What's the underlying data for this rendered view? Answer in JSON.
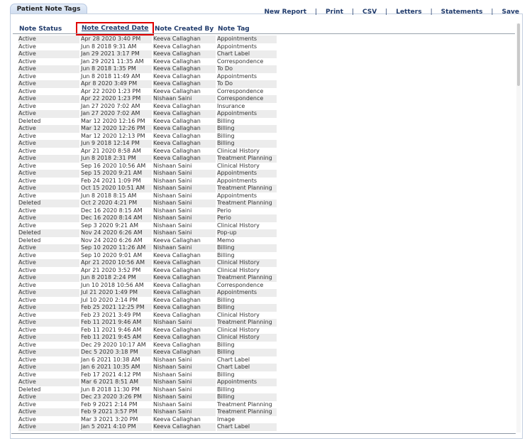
{
  "panel": {
    "title": "Patient Note Tags"
  },
  "toolbar": {
    "new_report": "New Report",
    "print": "Print",
    "csv": "CSV",
    "letters": "Letters",
    "statements": "Statements",
    "save": "Save",
    "separator": "|"
  },
  "table": {
    "columns": [
      "Note Status",
      "Note Created Date",
      "Note Created By",
      "Note Tag"
    ],
    "sorted_column": "Note Created Date",
    "rows": [
      [
        "Active",
        "Apr 28 2020 3:40 PM",
        "Keeva Callaghan",
        "Appointments"
      ],
      [
        "Active",
        "Jun 8 2018 9:31 AM",
        "Keeva Callaghan",
        "Appointments"
      ],
      [
        "Active",
        "Jan 29 2021 3:17 PM",
        "Keeva Callaghan",
        "Chart Label"
      ],
      [
        "Active",
        "Jan 29 2021 11:35 AM",
        "Keeva Callaghan",
        "Correspondence"
      ],
      [
        "Active",
        "Jun 8 2018 1:35 PM",
        "Keeva Callaghan",
        "To Do"
      ],
      [
        "Active",
        "Jun 8 2018 11:49 AM",
        "Keeva Callaghan",
        "Appointments"
      ],
      [
        "Active",
        "Apr 8 2020 3:49 PM",
        "Keeva Callaghan",
        "To Do"
      ],
      [
        "Active",
        "Apr 22 2020 1:23 PM",
        "Keeva Callaghan",
        "Correspondence"
      ],
      [
        "Active",
        "Apr 22 2020 1:23 PM",
        "Nishaan Saini",
        "Correspondence"
      ],
      [
        "Active",
        "Jan 27 2020 7:02 AM",
        "Keeva Callaghan",
        "Insurance"
      ],
      [
        "Active",
        "Jan 27 2020 7:02 AM",
        "Keeva Callaghan",
        "Appointments"
      ],
      [
        "Deleted",
        "Mar 12 2020 12:16 PM",
        "Keeva Callaghan",
        "Billing"
      ],
      [
        "Active",
        "Mar 12 2020 12:26 PM",
        "Keeva Callaghan",
        "Billing"
      ],
      [
        "Active",
        "Mar 12 2020 12:13 PM",
        "Keeva Callaghan",
        "Billing"
      ],
      [
        "Active",
        "Jun 9 2018 12:14 PM",
        "Keeva Callaghan",
        "Billing"
      ],
      [
        "Active",
        "Apr 21 2020 8:58 AM",
        "Keeva Callaghan",
        "Clinical History"
      ],
      [
        "Active",
        "Jun 8 2018 2:31 PM",
        "Keeva Callaghan",
        "Treatment Planning"
      ],
      [
        "Active",
        "Sep 16 2020 10:56 AM",
        "Nishaan Saini",
        "Clinical History"
      ],
      [
        "Active",
        "Sep 15 2020 9:21 AM",
        "Nishaan Saini",
        "Appointments"
      ],
      [
        "Active",
        "Feb 24 2021 1:09 PM",
        "Nishaan Saini",
        "Appointments"
      ],
      [
        "Active",
        "Oct 15 2020 10:51 AM",
        "Nishaan Saini",
        "Treatment Planning"
      ],
      [
        "Active",
        "Jun 8 2018 8:15 AM",
        "Nishaan Saini",
        "Appointments"
      ],
      [
        "Deleted",
        "Oct 2 2020 4:21 PM",
        "Nishaan Saini",
        "Treatment Planning"
      ],
      [
        "Active",
        "Dec 16 2020 8:15 AM",
        "Nishaan Saini",
        "Perio"
      ],
      [
        "Active",
        "Dec 16 2020 8:14 AM",
        "Nishaan Saini",
        "Perio"
      ],
      [
        "Active",
        "Sep 3 2020 9:21 AM",
        "Nishaan Saini",
        "Clinical History"
      ],
      [
        "Deleted",
        "Nov 24 2020 6:26 AM",
        "Nishaan Saini",
        "Pop-up"
      ],
      [
        "Deleted",
        "Nov 24 2020 6:26 AM",
        "Keeva Callaghan",
        "Memo"
      ],
      [
        "Active",
        "Sep 10 2020 11:26 AM",
        "Nishaan Saini",
        "Billing"
      ],
      [
        "Active",
        "Sep 10 2020 9:01 AM",
        "Keeva Callaghan",
        "Billing"
      ],
      [
        "Active",
        "Apr 21 2020 10:56 AM",
        "Keeva Callaghan",
        "Clinical History"
      ],
      [
        "Active",
        "Apr 21 2020 3:52 PM",
        "Keeva Callaghan",
        "Clinical History"
      ],
      [
        "Active",
        "Jun 8 2018 2:24 PM",
        "Keeva Callaghan",
        "Treatment Planning"
      ],
      [
        "Active",
        "Jun 10 2018 10:56 AM",
        "Keeva Callaghan",
        "Correspondence"
      ],
      [
        "Active",
        "Jul 21 2020 1:49 PM",
        "Keeva Callaghan",
        "Appointments"
      ],
      [
        "Active",
        "Jul 10 2020 2:14 PM",
        "Keeva Callaghan",
        "Billing"
      ],
      [
        "Active",
        "Feb 25 2021 12:25 PM",
        "Keeva Callaghan",
        "Billing"
      ],
      [
        "Active",
        "Feb 23 2021 3:49 PM",
        "Keeva Callaghan",
        "Clinical History"
      ],
      [
        "Active",
        "Feb 11 2021 9:46 AM",
        "Nishaan Saini",
        "Treatment Planning"
      ],
      [
        "Active",
        "Feb 11 2021 9:46 AM",
        "Keeva Callaghan",
        "Clinical History"
      ],
      [
        "Active",
        "Feb 11 2021 9:45 AM",
        "Keeva Callaghan",
        "Clinical History"
      ],
      [
        "Active",
        "Dec 29 2020 10:17 AM",
        "Keeva Callaghan",
        "Billing"
      ],
      [
        "Active",
        "Dec 5 2020 3:18 PM",
        "Keeva Callaghan",
        "Billing"
      ],
      [
        "Active",
        "Jan 6 2021 10:38 AM",
        "Nishaan Saini",
        "Chart Label"
      ],
      [
        "Active",
        "Jan 6 2021 10:35 AM",
        "Nishaan Saini",
        "Chart Label"
      ],
      [
        "Active",
        "Feb 17 2021 4:12 PM",
        "Nishaan Saini",
        "Billing"
      ],
      [
        "Active",
        "Mar 6 2021 8:51 AM",
        "Nishaan Saini",
        "Appointments"
      ],
      [
        "Deleted",
        "Jun 8 2018 11:30 PM",
        "Nishaan Saini",
        "Billing"
      ],
      [
        "Active",
        "Dec 23 2020 3:26 PM",
        "Nishaan Saini",
        "Billing"
      ],
      [
        "Active",
        "Feb 9 2021 2:14 PM",
        "Nishaan Saini",
        "Treatment Planning"
      ],
      [
        "Active",
        "Feb 9 2021 3:57 PM",
        "Nishaan Saini",
        "Treatment Planning"
      ],
      [
        "Active",
        "Mar 3 2021 3:20 PM",
        "Keeva Callaghan",
        "Image"
      ],
      [
        "Active",
        "Jan 5 2021 4:10 PM",
        "Keeva Callaghan",
        "Chart Label"
      ]
    ]
  },
  "colors": {
    "header_text": "#1f3a6b",
    "sort_highlight": "#e00000",
    "row_shade": "#ececec"
  }
}
